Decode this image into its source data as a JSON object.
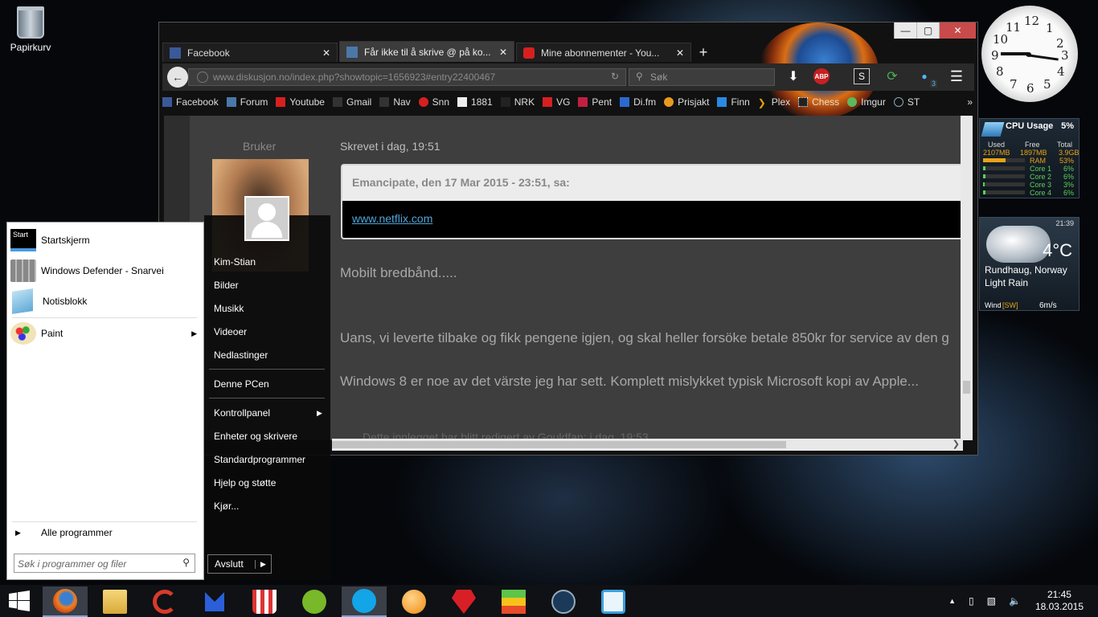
{
  "desktop": {
    "recycle_bin": "Papirkurv"
  },
  "browser": {
    "tabs": [
      {
        "label": "Facebook",
        "icon": "facebook-icon"
      },
      {
        "label": "Får ikke til å skrive @ på ko...",
        "icon": "diskusjon-icon"
      },
      {
        "label": "Mine abonnementer - You...",
        "icon": "youtube-icon"
      }
    ],
    "url": "www.diskusjon.no/index.php?showtopic=1656923#entry22400467",
    "search_placeholder": "Søk",
    "notification_count": "3",
    "bookmarks": [
      "Facebook",
      "Forum",
      "Youtube",
      "Gmail",
      "Nav",
      "Snn",
      "1881",
      "NRK",
      "VG",
      "Pent",
      "Di.fm",
      "Prisjakt",
      "Finn",
      "Plex",
      "Chess",
      "Imgur",
      "ST"
    ],
    "bookmarks_more": "»",
    "post": {
      "user_role": "Bruker",
      "posted": "Skrevet i dag, 19:51",
      "quote_header": "Emancipate, den 17 Mar 2015 - 23:51, sa:",
      "quote_link": "www.netflix.com",
      "para1": "Mobilt bredbånd.....",
      "para2": "Uans, vi leverte tilbake og fikk pengene igjen, og skal heller forsöke betale 850kr for service av den g",
      "para3": "Windows 8 er noe av det värste jeg har sett. Komplett mislykket typisk Microsoft kopi av Apple...",
      "edit_note": "Dette innlegget har blitt redigert av Gouldfan: i dag, 19:53"
    }
  },
  "start_menu": {
    "pinned": [
      {
        "label": "Startskjerm",
        "icon": "start-screen-icon"
      },
      {
        "label": "Windows Defender - Snarvei",
        "icon": "defender-icon"
      },
      {
        "label": "Notisblokk",
        "icon": "notepad-icon"
      },
      {
        "label": "Paint",
        "icon": "paint-icon"
      }
    ],
    "start_badge": "Start",
    "all_programs": "Alle programmer",
    "search_placeholder": "Søk i programmer og filer",
    "user_name": "Kim-Stian",
    "right_items": [
      "Bilder",
      "Musikk",
      "Videoer",
      "Nedlastinger"
    ],
    "computer": "Denne PCen",
    "control": [
      "Kontrollpanel",
      "Enheter og skrivere",
      "Standardprogrammer",
      "Hjelp og støtte",
      "Kjør..."
    ],
    "shutdown": "Avslutt"
  },
  "clock_gadget": {
    "numbers": [
      "12",
      "1",
      "2",
      "3",
      "4",
      "5",
      "6",
      "7",
      "8",
      "9",
      "10",
      "11"
    ]
  },
  "cpu_gadget": {
    "title": "CPU Usage",
    "percent": "5%",
    "used_label": "Used",
    "free_label": "Free",
    "total_label": "Total",
    "used": "2107MB",
    "free": "1897MB",
    "total": "3.9GB",
    "ram_label": "RAM",
    "ram": "53%",
    "cores": [
      {
        "label": "Core 1",
        "value": "6%"
      },
      {
        "label": "Core 2",
        "value": "6%"
      },
      {
        "label": "Core 3",
        "value": "3%"
      },
      {
        "label": "Core 4",
        "value": "6%"
      }
    ]
  },
  "weather_gadget": {
    "time": "21:39",
    "temp": "4°C",
    "location": "Rundhaug, Norway",
    "condition": "Light Rain",
    "wind_label": "Wind",
    "wind_dir": "[SW]",
    "wind": "6m/s"
  },
  "taskbar": {
    "apps": [
      "firefox-icon",
      "explorer-icon",
      "ccleaner-icon",
      "malwarebytes-icon",
      "popcorn-time-icon",
      "utorrent-icon",
      "skype-icon",
      "vlc-icon",
      "ruby-icon",
      "bluestacks-icon",
      "steam-icon",
      "utorrent-remote-icon"
    ],
    "time": "21:45",
    "date": "18.03.2015"
  }
}
